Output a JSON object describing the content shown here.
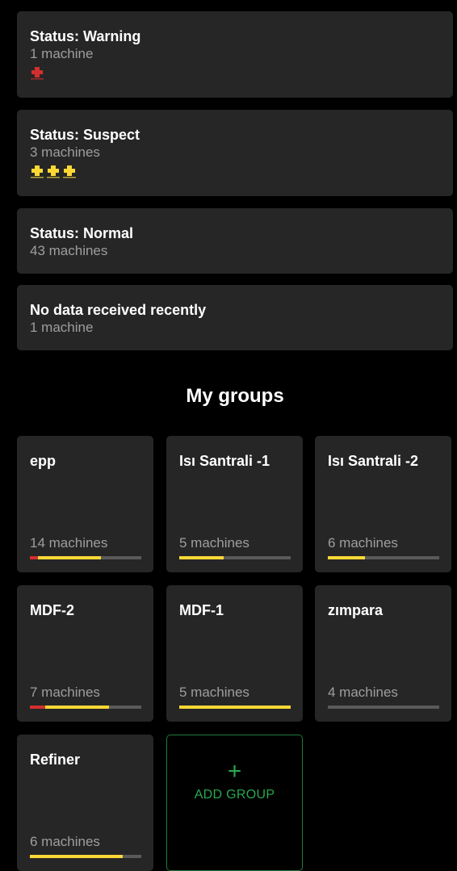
{
  "colors": {
    "background": "#000000",
    "card": "#262626",
    "text_primary": "#ffffff",
    "text_secondary": "#9e9e9e",
    "warning": "#d32f2f",
    "suspect": "#fdd835",
    "bar_track": "#5a5a5a",
    "add_accent": "#29a84e"
  },
  "status_cards": [
    {
      "title": "Status: Warning",
      "subtitle": "1 machine",
      "icons": [
        {
          "name": "machine-warning-icon",
          "color": "#d32f2f"
        }
      ]
    },
    {
      "title": "Status: Suspect",
      "subtitle": "3 machines",
      "icons": [
        {
          "name": "machine-suspect-icon",
          "color": "#fdd835"
        },
        {
          "name": "machine-suspect-icon",
          "color": "#fdd835"
        },
        {
          "name": "machine-suspect-icon",
          "color": "#fdd835"
        }
      ]
    },
    {
      "title": "Status: Normal",
      "subtitle": "43 machines",
      "icons": []
    },
    {
      "title": "No data received recently",
      "subtitle": "1 machine",
      "icons": []
    }
  ],
  "groups_section": {
    "title": "My groups"
  },
  "groups": [
    {
      "name": "epp",
      "count_label": "14 machines",
      "status_share": {
        "warning": 0.07,
        "suspect": 0.57
      }
    },
    {
      "name": "Isı Santrali -1",
      "count_label": "5 machines",
      "status_share": {
        "warning": 0,
        "suspect": 0.4
      }
    },
    {
      "name": "Isı Santrali -2",
      "count_label": "6 machines",
      "status_share": {
        "warning": 0,
        "suspect": 0.33
      }
    },
    {
      "name": "MDF-2",
      "count_label": "7 machines",
      "status_share": {
        "warning": 0.14,
        "suspect": 0.57
      }
    },
    {
      "name": "MDF-1",
      "count_label": "5 machines",
      "status_share": {
        "warning": 0,
        "suspect": 1.0
      }
    },
    {
      "name": "zımpara",
      "count_label": "4 machines",
      "status_share": {
        "warning": 0,
        "suspect": 0
      }
    },
    {
      "name": "Refiner",
      "count_label": "6 machines",
      "status_share": {
        "warning": 0,
        "suspect": 0.83
      }
    }
  ],
  "add_group": {
    "plus": "+",
    "label": "ADD GROUP"
  }
}
